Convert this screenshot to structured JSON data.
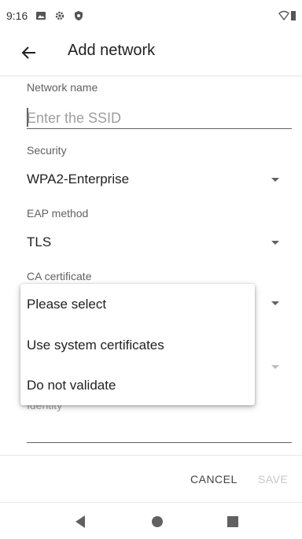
{
  "status_bar": {
    "time": "9:16",
    "icons": [
      "gallery-icon",
      "gear-icon",
      "shield-icon",
      "wifi-icon",
      "battery-icon"
    ]
  },
  "app_bar": {
    "back_icon": "arrow-left-icon",
    "title": "Add network"
  },
  "form": {
    "network_name_label": "Network name",
    "ssid_placeholder": "Enter the SSID",
    "ssid_value": "",
    "security_label": "Security",
    "security_value": "WPA2-Enterprise",
    "eap_label": "EAP method",
    "eap_value": "TLS",
    "ca_label": "CA certificate",
    "identity_label": "Identity"
  },
  "dropdown": {
    "options": [
      "Please select",
      "Use system certificates",
      "Do not validate"
    ]
  },
  "actions": {
    "cancel": "CANCEL",
    "save": "SAVE"
  },
  "nav": {
    "back_icon": "nav-back-icon",
    "home_icon": "nav-home-icon",
    "recent_icon": "nav-recents-icon"
  },
  "colors": {
    "text_primary": "#212121",
    "text_secondary": "#616161",
    "disabled": "#c8c8c8",
    "divider": "#e6e6e6"
  }
}
